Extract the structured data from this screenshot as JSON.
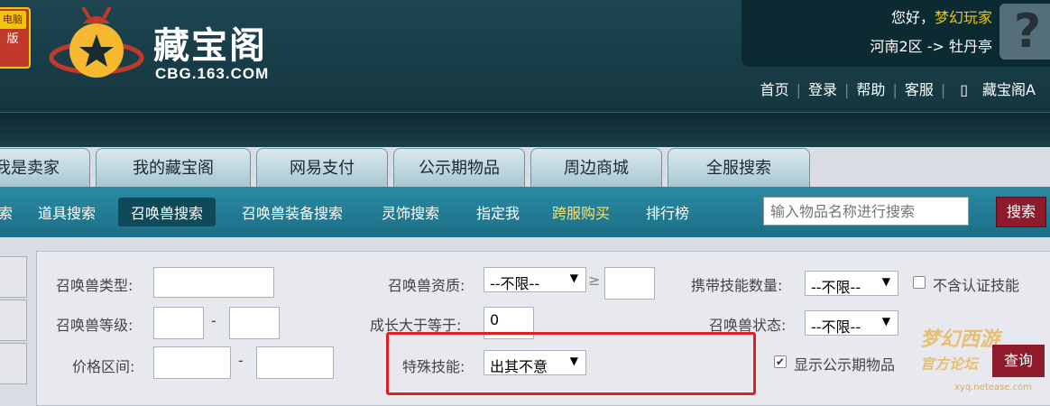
{
  "brand": {
    "badge_top": "电脑",
    "badge_bottom": "版",
    "title": "藏宝阁",
    "url": "CBG.163.COM"
  },
  "user": {
    "greeting": "您好，",
    "username": "梦幻玩家",
    "server": "河南2区 -> 牡丹亭",
    "avatar_icon": "question-avatar-icon"
  },
  "top_nav": [
    "首页",
    "登录",
    "帮助",
    "客服",
    "藏宝阁A"
  ],
  "tabs": [
    "我是卖家",
    "我的藏宝阁",
    "网易支付",
    "公示期物品",
    "周边商城",
    "全服搜索"
  ],
  "sub_nav": [
    "索",
    "道具搜索",
    "召唤兽搜索",
    "召唤兽装备搜索",
    "灵饰搜索",
    "指定我",
    "跨服购买",
    "排行榜"
  ],
  "search": {
    "placeholder": "输入物品名称进行搜索",
    "button": "搜索"
  },
  "form": {
    "pet_type_label": "召唤兽类型:",
    "pet_level_label": "召唤兽等级:",
    "price_label": "价格区间:",
    "aptitude_label": "召唤兽资质:",
    "aptitude_value": "--不限--",
    "gte_symbol": "≥",
    "growth_label": "成长大于等于:",
    "growth_value": "0",
    "special_skill_label": "特殊技能:",
    "special_skill_value": "出其不意",
    "skill_count_label": "携带技能数量:",
    "skill_count_value": "--不限--",
    "pet_status_label": "召唤兽状态:",
    "pet_status_value": "--不限--",
    "exclude_cert_label": "不含认证技能",
    "show_public_label": "显示公示期物品",
    "query_button": "查询",
    "dash": "-"
  },
  "watermark": {
    "text": "梦幻西游",
    "sub_text": "官方论坛",
    "url": "xyq.netease.com"
  }
}
